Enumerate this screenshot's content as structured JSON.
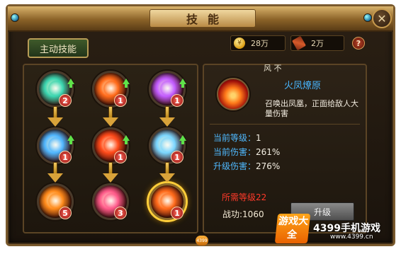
{
  "window": {
    "title": "技能"
  },
  "tabs": [
    {
      "label": "主动技能",
      "active": true
    }
  ],
  "resources": {
    "gold": "28万",
    "gold_icon_symbol": "¥",
    "items": "2万"
  },
  "help_label": "?",
  "close_label": "✕",
  "selected_skill_tag": "风 不",
  "skills": [
    {
      "level": "2",
      "can_upgrade": true,
      "icon": "green-wind-strike-icon",
      "color": "#3ad6b0"
    },
    {
      "level": "1",
      "can_upgrade": true,
      "icon": "fire-burst-icon",
      "color": "#ff6a1a"
    },
    {
      "level": "1",
      "can_upgrade": true,
      "icon": "violet-slash-icon",
      "color": "#c25cff"
    },
    {
      "level": "1",
      "can_upgrade": true,
      "icon": "whirlwind-icon",
      "color": "#4fb6ff"
    },
    {
      "level": "1",
      "can_upgrade": true,
      "icon": "bow-shot-icon",
      "color": "#ff4a1a"
    },
    {
      "level": "1",
      "can_upgrade": true,
      "icon": "ice-blade-icon",
      "color": "#7ad6ff"
    },
    {
      "level": "5",
      "can_upgrade": false,
      "icon": "flame-wave-icon",
      "color": "#ff8a1a"
    },
    {
      "level": "3",
      "can_upgrade": false,
      "icon": "pink-claw-icon",
      "color": "#ff5a8a"
    },
    {
      "level": "1",
      "can_upgrade": false,
      "icon": "phoenix-flame-icon",
      "color": "#ff6a1a",
      "selected": true
    }
  ],
  "detail": {
    "name": "火凤燎原",
    "description": "召唤出凤凰，正面给敌人大量伤害",
    "stats": [
      {
        "label": "当前等级：",
        "value": "1"
      },
      {
        "label": "当前伤害：",
        "value": "261%"
      },
      {
        "label": "升级伤害：",
        "value": "276%"
      }
    ],
    "requirement": "所需等级22",
    "merit_label": "战功:",
    "merit_value": "1060",
    "upgrade_label": "升级"
  },
  "watermark": {
    "logo": "游戏大全",
    "text": "4399手机游戏",
    "url": "www.4399.cn"
  },
  "bottom_badge": "4399"
}
